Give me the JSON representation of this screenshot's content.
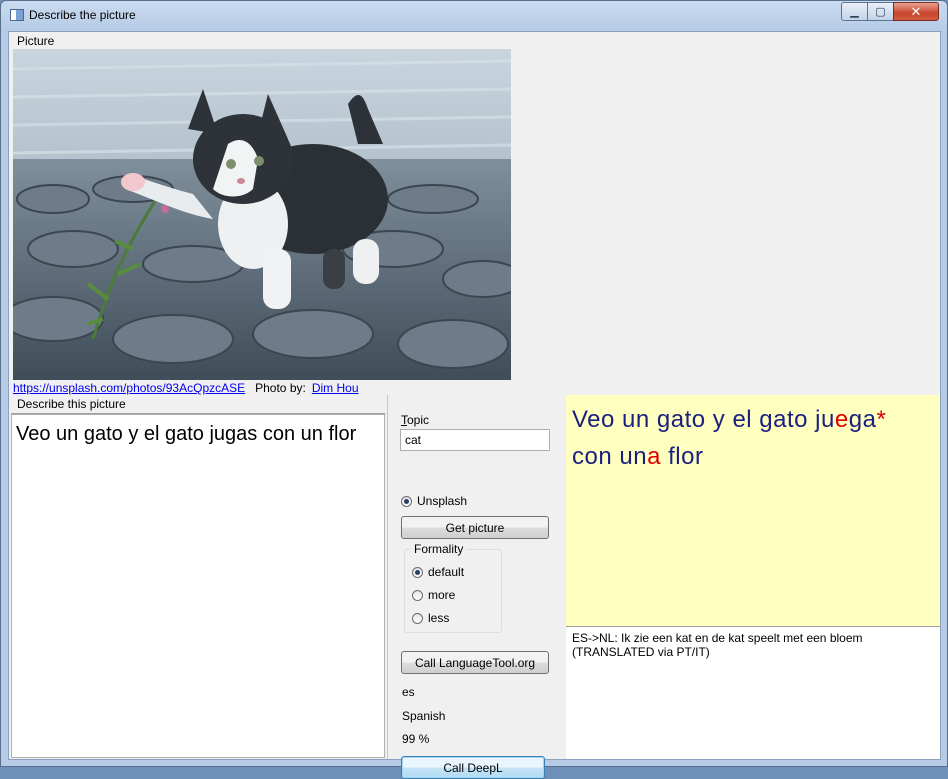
{
  "window": {
    "title": "Describe the picture"
  },
  "picture": {
    "label": "Picture",
    "source_url": "https://unsplash.com/photos/93AcQpzcASE",
    "photo_by_label": "Photo by:",
    "photographer": "Dim Hou"
  },
  "describe": {
    "label": "Describe this picture",
    "text": "Veo un gato y el gato jugas con un flor"
  },
  "controls": {
    "topic_label": "opic",
    "topic_label_mnemonic": "T",
    "topic_value": "cat",
    "source_option": "Unsplash",
    "get_picture_label": "Get picture",
    "formality": {
      "title": "Formality",
      "options": [
        "default",
        "more",
        "less"
      ],
      "selected": "default"
    },
    "languagetool_label": "Call LanguageTool.org",
    "lang_code": "es",
    "lang_name": "Spanish",
    "confidence": "99 %",
    "deepl_label": "Call DeepL"
  },
  "correction": {
    "segments": [
      {
        "text": "Veo un gato y el gato ju",
        "err": false
      },
      {
        "text": "e",
        "err": true
      },
      {
        "text": "ga",
        "err": false
      },
      {
        "text": "*",
        "err": true
      },
      {
        "text": " con un",
        "err": false
      },
      {
        "text": "a",
        "err": true
      },
      {
        "text": " flor",
        "err": false
      }
    ]
  },
  "translation": {
    "text": "ES->NL: Ik zie een kat en de kat speelt met een bloem (TRANSLATED via PT/IT)"
  },
  "colors": {
    "correction_bg": "#ffffc0",
    "correction_text": "#1a1f80",
    "error_text": "#e00000",
    "link": "#0000ee"
  }
}
